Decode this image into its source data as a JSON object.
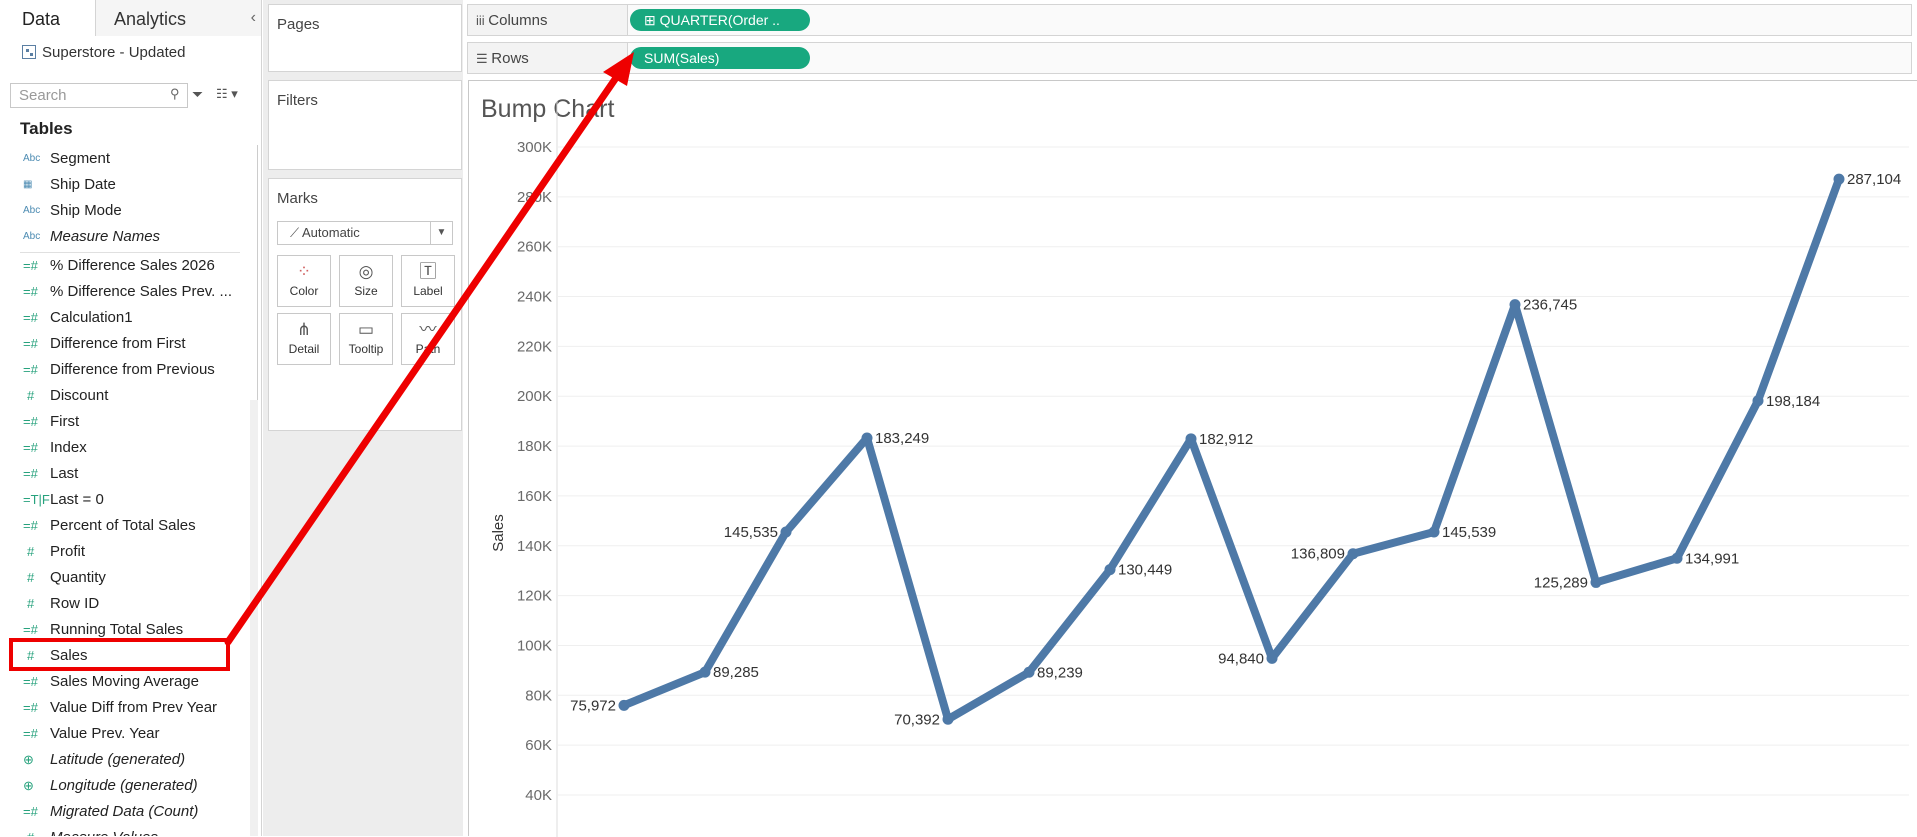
{
  "data_pane": {
    "tabs": [
      "Data",
      "Analytics"
    ],
    "collapse_symbol": "‹",
    "datasource": "Superstore - Updated",
    "search_placeholder": "Search",
    "tables_heading": "Tables",
    "dimensions": [
      {
        "label": "Segment",
        "icon": "Abc",
        "italic": false
      },
      {
        "label": "Ship Date",
        "icon": "calendar",
        "italic": false
      },
      {
        "label": "Ship Mode",
        "icon": "Abc",
        "italic": false
      },
      {
        "label": "Measure Names",
        "icon": "Abc",
        "italic": true
      }
    ],
    "measures": [
      {
        "label": "% Difference Sales 2026",
        "icon": "=#",
        "italic": false
      },
      {
        "label": "% Difference Sales Prev. ...",
        "icon": "=#",
        "italic": false
      },
      {
        "label": "Calculation1",
        "icon": "=#",
        "italic": false
      },
      {
        "label": "Difference from First",
        "icon": "=#",
        "italic": false
      },
      {
        "label": "Difference from Previous",
        "icon": "=#",
        "italic": false
      },
      {
        "label": "Discount",
        "icon": "#",
        "italic": false
      },
      {
        "label": "First",
        "icon": "=#",
        "italic": false
      },
      {
        "label": "Index",
        "icon": "=#",
        "italic": false
      },
      {
        "label": "Last",
        "icon": "=#",
        "italic": false
      },
      {
        "label": "Last = 0",
        "icon": "=T|F",
        "italic": false
      },
      {
        "label": "Percent of Total Sales",
        "icon": "=#",
        "italic": false
      },
      {
        "label": "Profit",
        "icon": "#",
        "italic": false
      },
      {
        "label": "Quantity",
        "icon": "#",
        "italic": false
      },
      {
        "label": "Row ID",
        "icon": "#",
        "italic": false
      },
      {
        "label": "Running Total Sales",
        "icon": "=#",
        "italic": false
      },
      {
        "label": "Sales",
        "icon": "#",
        "italic": false
      },
      {
        "label": "Sales Moving Average",
        "icon": "=#",
        "italic": false
      },
      {
        "label": "Value Diff from Prev Year",
        "icon": "=#",
        "italic": false
      },
      {
        "label": "Value Prev. Year",
        "icon": "=#",
        "italic": false
      },
      {
        "label": "Latitude (generated)",
        "icon": "globe",
        "italic": true
      },
      {
        "label": "Longitude (generated)",
        "icon": "globe",
        "italic": true
      },
      {
        "label": "Migrated Data (Count)",
        "icon": "=#",
        "italic": true
      },
      {
        "label": "Measure Values",
        "icon": "#",
        "italic": true
      }
    ]
  },
  "cards": {
    "pages": "Pages",
    "filters": "Filters",
    "marks": "Marks",
    "mark_type": "Automatic",
    "mark_buttons": [
      "Color",
      "Size",
      "Label",
      "Detail",
      "Tooltip",
      "Path"
    ]
  },
  "shelves": {
    "columns_label": "Columns",
    "rows_label": "Rows",
    "columns_pill": "⊞ QUARTER(Order ..",
    "rows_pill": "SUM(Sales)"
  },
  "colors": {
    "pill": "#18a87f",
    "line": "#4e79a7",
    "highlight": "#ee0000"
  },
  "chart_data": {
    "type": "line",
    "title": "Bump Chart",
    "ylabel": "Sales",
    "ylim": [
      40000,
      300000
    ],
    "yticks": [
      "40K",
      "60K",
      "80K",
      "100K",
      "120K",
      "140K",
      "160K",
      "180K",
      "200K",
      "220K",
      "240K",
      "260K",
      "280K",
      "300K"
    ],
    "ytick_values": [
      40000,
      60000,
      80000,
      100000,
      120000,
      140000,
      160000,
      180000,
      200000,
      220000,
      240000,
      260000,
      280000,
      300000
    ],
    "series": [
      {
        "values": [
          75972,
          89285,
          145535,
          183249,
          70392,
          89239,
          130449,
          182912,
          94840,
          136809,
          145539,
          236745,
          125289,
          134991,
          198184,
          287104
        ],
        "labels": [
          "75,972",
          "89,285",
          "145,535",
          "183,249",
          "70,392",
          "89,239",
          "130,449",
          "182,912",
          "94,840",
          "136,809",
          "145,539",
          "236,745",
          "125,289",
          "134,991",
          "198,184",
          "287,104"
        ]
      }
    ],
    "grid": true
  }
}
